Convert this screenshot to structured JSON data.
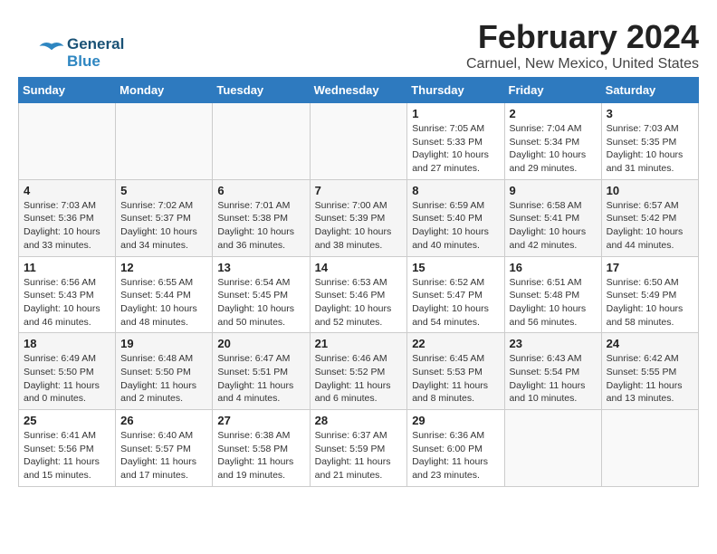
{
  "logo": {
    "line1": "General",
    "line2": "Blue"
  },
  "header": {
    "month_year": "February 2024",
    "location": "Carnuel, New Mexico, United States"
  },
  "days_of_week": [
    "Sunday",
    "Monday",
    "Tuesday",
    "Wednesday",
    "Thursday",
    "Friday",
    "Saturday"
  ],
  "weeks": [
    [
      {
        "day": "",
        "info": ""
      },
      {
        "day": "",
        "info": ""
      },
      {
        "day": "",
        "info": ""
      },
      {
        "day": "",
        "info": ""
      },
      {
        "day": "1",
        "info": "Sunrise: 7:05 AM\nSunset: 5:33 PM\nDaylight: 10 hours and 27 minutes."
      },
      {
        "day": "2",
        "info": "Sunrise: 7:04 AM\nSunset: 5:34 PM\nDaylight: 10 hours and 29 minutes."
      },
      {
        "day": "3",
        "info": "Sunrise: 7:03 AM\nSunset: 5:35 PM\nDaylight: 10 hours and 31 minutes."
      }
    ],
    [
      {
        "day": "4",
        "info": "Sunrise: 7:03 AM\nSunset: 5:36 PM\nDaylight: 10 hours and 33 minutes."
      },
      {
        "day": "5",
        "info": "Sunrise: 7:02 AM\nSunset: 5:37 PM\nDaylight: 10 hours and 34 minutes."
      },
      {
        "day": "6",
        "info": "Sunrise: 7:01 AM\nSunset: 5:38 PM\nDaylight: 10 hours and 36 minutes."
      },
      {
        "day": "7",
        "info": "Sunrise: 7:00 AM\nSunset: 5:39 PM\nDaylight: 10 hours and 38 minutes."
      },
      {
        "day": "8",
        "info": "Sunrise: 6:59 AM\nSunset: 5:40 PM\nDaylight: 10 hours and 40 minutes."
      },
      {
        "day": "9",
        "info": "Sunrise: 6:58 AM\nSunset: 5:41 PM\nDaylight: 10 hours and 42 minutes."
      },
      {
        "day": "10",
        "info": "Sunrise: 6:57 AM\nSunset: 5:42 PM\nDaylight: 10 hours and 44 minutes."
      }
    ],
    [
      {
        "day": "11",
        "info": "Sunrise: 6:56 AM\nSunset: 5:43 PM\nDaylight: 10 hours and 46 minutes."
      },
      {
        "day": "12",
        "info": "Sunrise: 6:55 AM\nSunset: 5:44 PM\nDaylight: 10 hours and 48 minutes."
      },
      {
        "day": "13",
        "info": "Sunrise: 6:54 AM\nSunset: 5:45 PM\nDaylight: 10 hours and 50 minutes."
      },
      {
        "day": "14",
        "info": "Sunrise: 6:53 AM\nSunset: 5:46 PM\nDaylight: 10 hours and 52 minutes."
      },
      {
        "day": "15",
        "info": "Sunrise: 6:52 AM\nSunset: 5:47 PM\nDaylight: 10 hours and 54 minutes."
      },
      {
        "day": "16",
        "info": "Sunrise: 6:51 AM\nSunset: 5:48 PM\nDaylight: 10 hours and 56 minutes."
      },
      {
        "day": "17",
        "info": "Sunrise: 6:50 AM\nSunset: 5:49 PM\nDaylight: 10 hours and 58 minutes."
      }
    ],
    [
      {
        "day": "18",
        "info": "Sunrise: 6:49 AM\nSunset: 5:50 PM\nDaylight: 11 hours and 0 minutes."
      },
      {
        "day": "19",
        "info": "Sunrise: 6:48 AM\nSunset: 5:50 PM\nDaylight: 11 hours and 2 minutes."
      },
      {
        "day": "20",
        "info": "Sunrise: 6:47 AM\nSunset: 5:51 PM\nDaylight: 11 hours and 4 minutes."
      },
      {
        "day": "21",
        "info": "Sunrise: 6:46 AM\nSunset: 5:52 PM\nDaylight: 11 hours and 6 minutes."
      },
      {
        "day": "22",
        "info": "Sunrise: 6:45 AM\nSunset: 5:53 PM\nDaylight: 11 hours and 8 minutes."
      },
      {
        "day": "23",
        "info": "Sunrise: 6:43 AM\nSunset: 5:54 PM\nDaylight: 11 hours and 10 minutes."
      },
      {
        "day": "24",
        "info": "Sunrise: 6:42 AM\nSunset: 5:55 PM\nDaylight: 11 hours and 13 minutes."
      }
    ],
    [
      {
        "day": "25",
        "info": "Sunrise: 6:41 AM\nSunset: 5:56 PM\nDaylight: 11 hours and 15 minutes."
      },
      {
        "day": "26",
        "info": "Sunrise: 6:40 AM\nSunset: 5:57 PM\nDaylight: 11 hours and 17 minutes."
      },
      {
        "day": "27",
        "info": "Sunrise: 6:38 AM\nSunset: 5:58 PM\nDaylight: 11 hours and 19 minutes."
      },
      {
        "day": "28",
        "info": "Sunrise: 6:37 AM\nSunset: 5:59 PM\nDaylight: 11 hours and 21 minutes."
      },
      {
        "day": "29",
        "info": "Sunrise: 6:36 AM\nSunset: 6:00 PM\nDaylight: 11 hours and 23 minutes."
      },
      {
        "day": "",
        "info": ""
      },
      {
        "day": "",
        "info": ""
      }
    ]
  ]
}
